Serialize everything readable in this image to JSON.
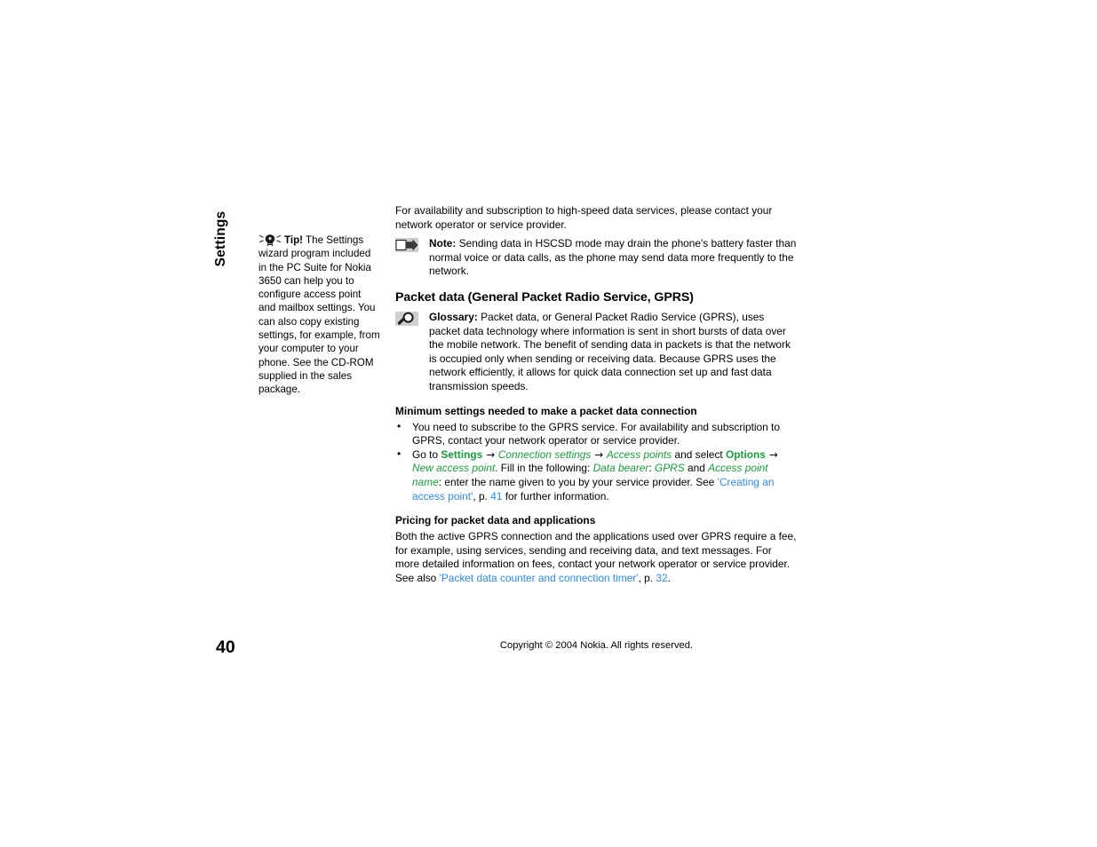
{
  "page": {
    "chapter_tab": "Settings",
    "folio": "40",
    "copyright": "Copyright © 2004 Nokia. All rights reserved."
  },
  "margin_note": {
    "icon": "lightbulb-tip-icon",
    "lead": "Tip!",
    "body": " The Settings wizard program included in the PC Suite for Nokia 3650 can help you to configure access point and mailbox settings. You can also copy existing settings, for example, from your computer to your phone. See the CD-ROM supplied in the sales package."
  },
  "main": {
    "intro_paragraph": "For availability and subscription to high-speed data services, please contact your network operator or service provider.",
    "note_callout": {
      "icon": "note-arrow-icon",
      "lead": "Note:",
      "body": " Sending data in HSCSD mode may drain the phone's battery faster than normal voice or data calls, as the phone may send data more frequently to the network."
    },
    "section_heading": "Packet data (General Packet Radio Service, GPRS)",
    "glossary_callout": {
      "icon": "magnifier-glossary-icon",
      "lead": "Glossary:",
      "body": " Packet data, or General Packet Radio Service (GPRS), uses packet data technology where information is sent in short bursts of data over the mobile network. The benefit of sending data in packets is that the network is occupied only when sending or receiving data. Because GPRS uses the network efficiently, it allows for quick data connection set up and fast data transmission speeds."
    },
    "subheading_minimum": "Minimum settings needed to make a packet data connection",
    "bullet_1": "You need to subscribe to the GPRS service. For availability and subscription to GPRS, contact your network operator or service provider.",
    "bullet_2": {
      "t1": "Go to ",
      "ui1": "Settings",
      "a1": " → ",
      "ui2": "Connection settings",
      "a2": " → ",
      "ui3": "Access points",
      "t2": " and select ",
      "ui4": "Options",
      "a3": " → ",
      "ui5": "New access point",
      "t3": ". Fill in the following: ",
      "ui6": "Data bearer",
      "t4": ": ",
      "ui7": "GPRS",
      "t5": " and ",
      "ui8": "Access point name",
      "t6": ": enter the name given to you by your service provider. See ",
      "xref1": "'Creating an access point'",
      "t7": ", p. ",
      "xref2": "41",
      "t8": " for further information."
    },
    "subheading_pricing": "Pricing for packet data and applications",
    "pricing_paragraph": {
      "t1": "Both the active GPRS connection and the applications used over GPRS require a fee, for example, using services, sending and receiving data, and text messages. For more detailed information on fees, contact your network operator or service provider. See also ",
      "xref1": "'Packet data counter and connection timer'",
      "t2": ", p. ",
      "xref2": "32",
      "t3": "."
    }
  },
  "colors": {
    "ui_green": "#1a9b3d",
    "xref_blue": "#2e8ae6",
    "text_black": "#000000",
    "icon_gray": "#c9c9c9"
  }
}
